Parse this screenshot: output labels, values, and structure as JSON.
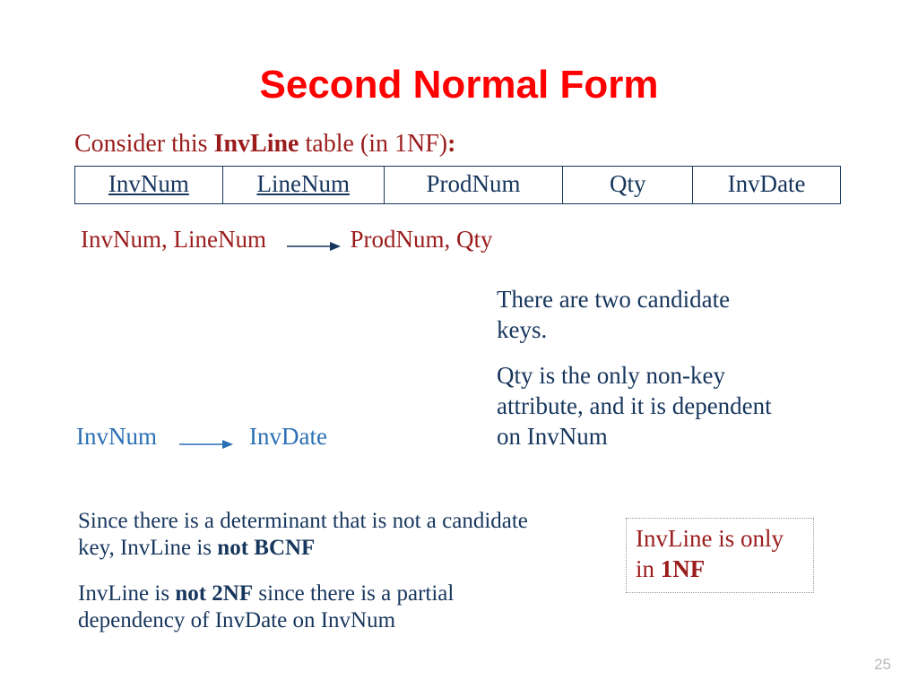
{
  "title": "Second Normal Form",
  "subtitle": {
    "pre": "Consider this ",
    "bold": "InvLine",
    "post": " table (in 1NF)",
    "colon": ":"
  },
  "columns": [
    "InvNum",
    "LineNum",
    "ProdNum",
    "Qty",
    "InvDate"
  ],
  "fd1": {
    "lhs": "InvNum, LineNum",
    "rhs": "ProdNum, Qty"
  },
  "fd2": {
    "lhs": "InvNum",
    "rhs": "InvDate"
  },
  "note1": "There are two candidate keys.",
  "note2": "Qty is the only non-key attribute, and it is dependent on InvNum",
  "para1": {
    "text_a": "Since there is a determinant that is not a candidate key, InvLine is ",
    "bold": "not BCNF"
  },
  "para2": {
    "text_a": "InvLine is ",
    "bold": "not 2NF",
    "text_b": " since there is a partial dependency of InvDate on InvNum"
  },
  "box": {
    "text_a": "InvLine is only in ",
    "bold": "1NF"
  },
  "page_number": "25"
}
